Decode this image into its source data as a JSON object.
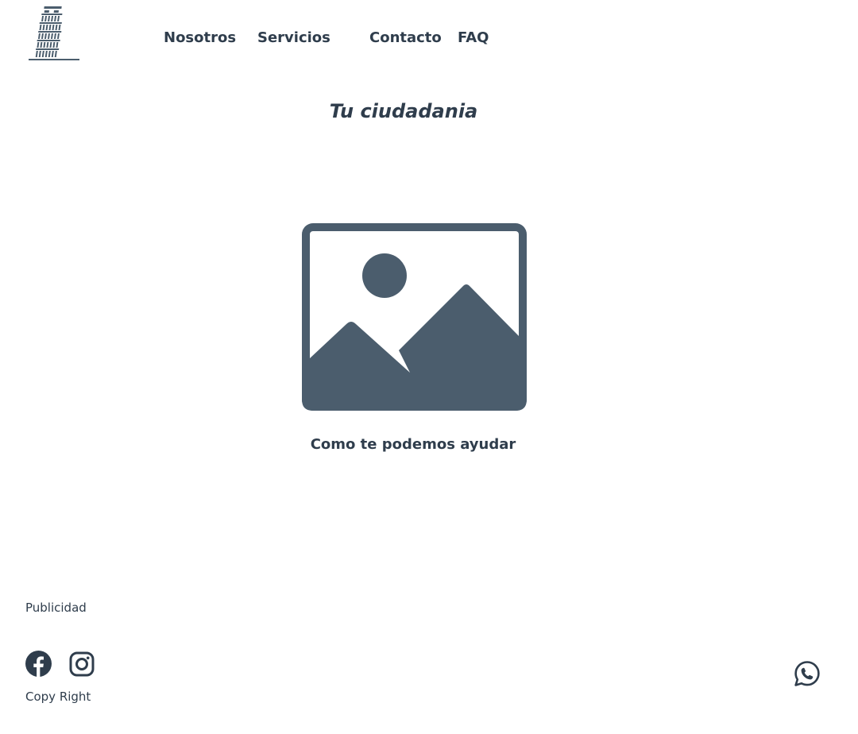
{
  "header": {
    "logo_icon": "leaning-tower-icon",
    "nav": [
      {
        "label": "Nosotros"
      },
      {
        "label": "Servicios"
      },
      {
        "label": "Contacto"
      },
      {
        "label": "FAQ"
      }
    ]
  },
  "main": {
    "title": "Tu ciudadania",
    "image_icon": "image-placeholder-icon",
    "caption": "Como te podemos ayudar"
  },
  "footer": {
    "advertising_label": "Publicidad",
    "social": [
      {
        "icon": "facebook-icon"
      },
      {
        "icon": "instagram-icon"
      }
    ],
    "copyright": "Copy Right",
    "chat_icon": "whatsapp-icon"
  },
  "colors": {
    "text": "#2f3d4c",
    "icon": "#4b5d6d",
    "background": "#ffffff"
  }
}
